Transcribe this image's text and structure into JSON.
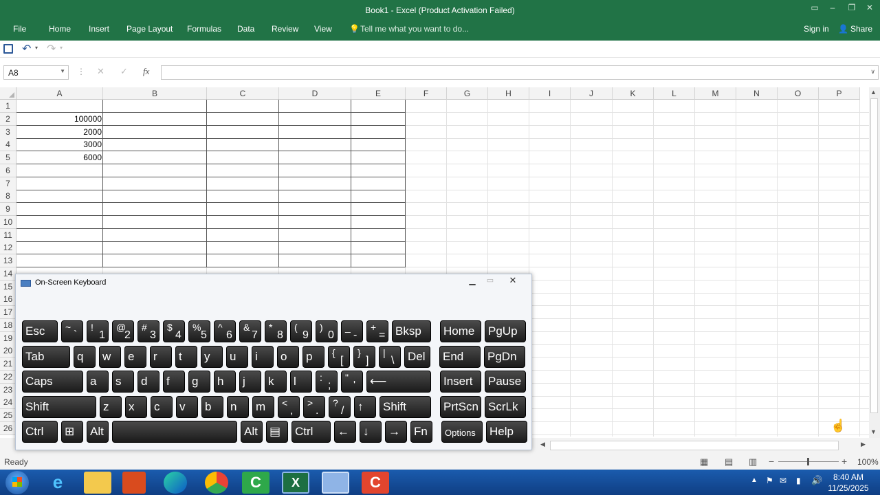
{
  "window": {
    "title": "Book1 - Excel (Product Activation Failed)"
  },
  "ribbon": {
    "tabs": [
      "File",
      "Home",
      "Insert",
      "Page Layout",
      "Formulas",
      "Data",
      "Review",
      "View"
    ],
    "tell_me": "Tell me what you want to do...",
    "sign_in": "Sign in",
    "share": "Share"
  },
  "formula_bar": {
    "name_box": "A8",
    "fx": "fx",
    "formula": ""
  },
  "sheet": {
    "columns": [
      "A",
      "B",
      "C",
      "D",
      "E",
      "F",
      "G",
      "H",
      "I",
      "J",
      "K",
      "L",
      "M",
      "N",
      "O",
      "P"
    ],
    "rows": [
      "1",
      "2",
      "3",
      "4",
      "5",
      "6",
      "7",
      "8",
      "9",
      "10",
      "11",
      "12",
      "13",
      "14",
      "15",
      "16",
      "17",
      "18",
      "19",
      "20",
      "21",
      "22",
      "23",
      "24",
      "25",
      "26"
    ],
    "cells": {
      "A2": "100000",
      "A3": "2000",
      "A4": "3000",
      "A5": "6000"
    }
  },
  "status": {
    "ready": "Ready",
    "zoom": "100%"
  },
  "osk": {
    "title": "On-Screen Keyboard",
    "rows": [
      [
        {
          "t": "Esc"
        },
        {
          "u": "~",
          "l": "`"
        },
        {
          "u": "!",
          "l": "1"
        },
        {
          "u": "@",
          "l": "2"
        },
        {
          "u": "#",
          "l": "3"
        },
        {
          "u": "$",
          "l": "4"
        },
        {
          "u": "%",
          "l": "5"
        },
        {
          "u": "^",
          "l": "6"
        },
        {
          "u": "&",
          "l": "7"
        },
        {
          "u": "*",
          "l": "8"
        },
        {
          "u": "(",
          "l": "9"
        },
        {
          "u": ")",
          "l": "0"
        },
        {
          "u": "_",
          "l": "-"
        },
        {
          "u": "+",
          "l": "="
        },
        {
          "t": "Bksp"
        },
        {
          "t": "Home"
        },
        {
          "t": "PgUp"
        }
      ],
      [
        {
          "t": "Tab"
        },
        {
          "t": "q"
        },
        {
          "t": "w"
        },
        {
          "t": "e"
        },
        {
          "t": "r"
        },
        {
          "t": "t"
        },
        {
          "t": "y"
        },
        {
          "t": "u"
        },
        {
          "t": "i"
        },
        {
          "t": "o"
        },
        {
          "t": "p"
        },
        {
          "u": "{",
          "l": "["
        },
        {
          "u": "}",
          "l": "]"
        },
        {
          "u": "|",
          "l": "\\"
        },
        {
          "t": "Del"
        },
        {
          "t": "End"
        },
        {
          "t": "PgDn"
        }
      ],
      [
        {
          "t": "Caps"
        },
        {
          "t": "a"
        },
        {
          "t": "s"
        },
        {
          "t": "d"
        },
        {
          "t": "f"
        },
        {
          "t": "g"
        },
        {
          "t": "h"
        },
        {
          "t": "j"
        },
        {
          "t": "k"
        },
        {
          "t": "l"
        },
        {
          "u": ":",
          "l": ";"
        },
        {
          "u": "\"",
          "l": "'"
        },
        {
          "t": "⟵"
        },
        {
          "t": "Insert"
        },
        {
          "t": "Pause"
        }
      ],
      [
        {
          "t": "Shift"
        },
        {
          "t": "z"
        },
        {
          "t": "x"
        },
        {
          "t": "c"
        },
        {
          "t": "v"
        },
        {
          "t": "b"
        },
        {
          "t": "n"
        },
        {
          "t": "m"
        },
        {
          "u": "<",
          "l": ","
        },
        {
          "u": ">",
          "l": "."
        },
        {
          "u": "?",
          "l": "/"
        },
        {
          "t": "↑"
        },
        {
          "t": "Shift"
        },
        {
          "t": "PrtScn"
        },
        {
          "t": "ScrLk"
        }
      ],
      [
        {
          "t": "Ctrl"
        },
        {
          "t": "⊞"
        },
        {
          "t": "Alt"
        },
        {
          "t": ""
        },
        {
          "t": "Alt"
        },
        {
          "t": "▤"
        },
        {
          "t": "Ctrl"
        },
        {
          "t": "←"
        },
        {
          "t": "↓"
        },
        {
          "t": "→"
        },
        {
          "t": "Fn"
        },
        {
          "t": "Options"
        },
        {
          "t": "Help"
        }
      ]
    ]
  },
  "taskbar": {
    "time": "8:40 AM",
    "date": "11/25/2025"
  },
  "colors": {
    "excel_green": "#217346",
    "taskbar": "#1b5cae"
  }
}
